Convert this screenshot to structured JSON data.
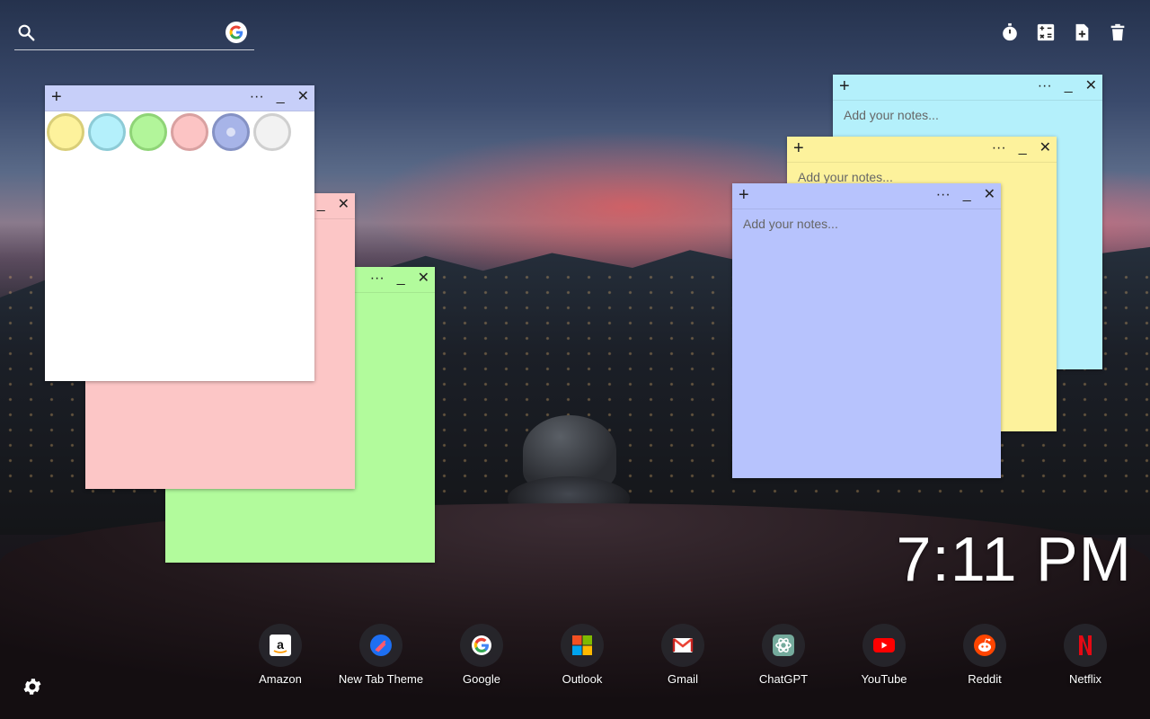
{
  "search": {
    "placeholder": "",
    "value": ""
  },
  "notes": {
    "placeholder": "Add your notes...",
    "plus": "+",
    "more": "···",
    "minimize": "_",
    "close": "✕"
  },
  "palette": {
    "colors": [
      {
        "name": "yellow",
        "fill": "#fdf29c",
        "border": "#d9ce78"
      },
      {
        "name": "cyan",
        "fill": "#b4f0fb",
        "border": "#8dcbd6"
      },
      {
        "name": "green",
        "fill": "#b2f59a",
        "border": "#8fd477"
      },
      {
        "name": "pink",
        "fill": "#fcc4c4",
        "border": "#d9a1a1"
      },
      {
        "name": "lavender",
        "fill": "#a7b4e8",
        "border": "#8592c4"
      },
      {
        "name": "white",
        "fill": "#f2f2f2",
        "border": "#cfcfcf"
      }
    ],
    "selected": "lavender"
  },
  "note_colors": {
    "white": "#ffffff",
    "pink": "#fcc6c6",
    "green": "#b2fb9c",
    "cyan": "#b4f0fb",
    "yellow": "#fdf29c",
    "lavender": "#b7c3fd",
    "white_bar": "#c7cff9",
    "pink_bar": "#fcc6c6",
    "green_bar": "#b2fb9c"
  },
  "clock": {
    "time": "7:11 PM"
  },
  "dock": [
    {
      "label": "Amazon",
      "icon": "amazon-icon"
    },
    {
      "label": "New Tab Theme",
      "icon": "new-tab-theme-icon"
    },
    {
      "label": "Google",
      "icon": "google-icon"
    },
    {
      "label": "Outlook",
      "icon": "outlook-icon"
    },
    {
      "label": "Gmail",
      "icon": "gmail-icon"
    },
    {
      "label": "ChatGPT",
      "icon": "chatgpt-icon"
    },
    {
      "label": "YouTube",
      "icon": "youtube-icon"
    },
    {
      "label": "Reddit",
      "icon": "reddit-icon"
    },
    {
      "label": "Netflix",
      "icon": "netflix-icon"
    }
  ]
}
